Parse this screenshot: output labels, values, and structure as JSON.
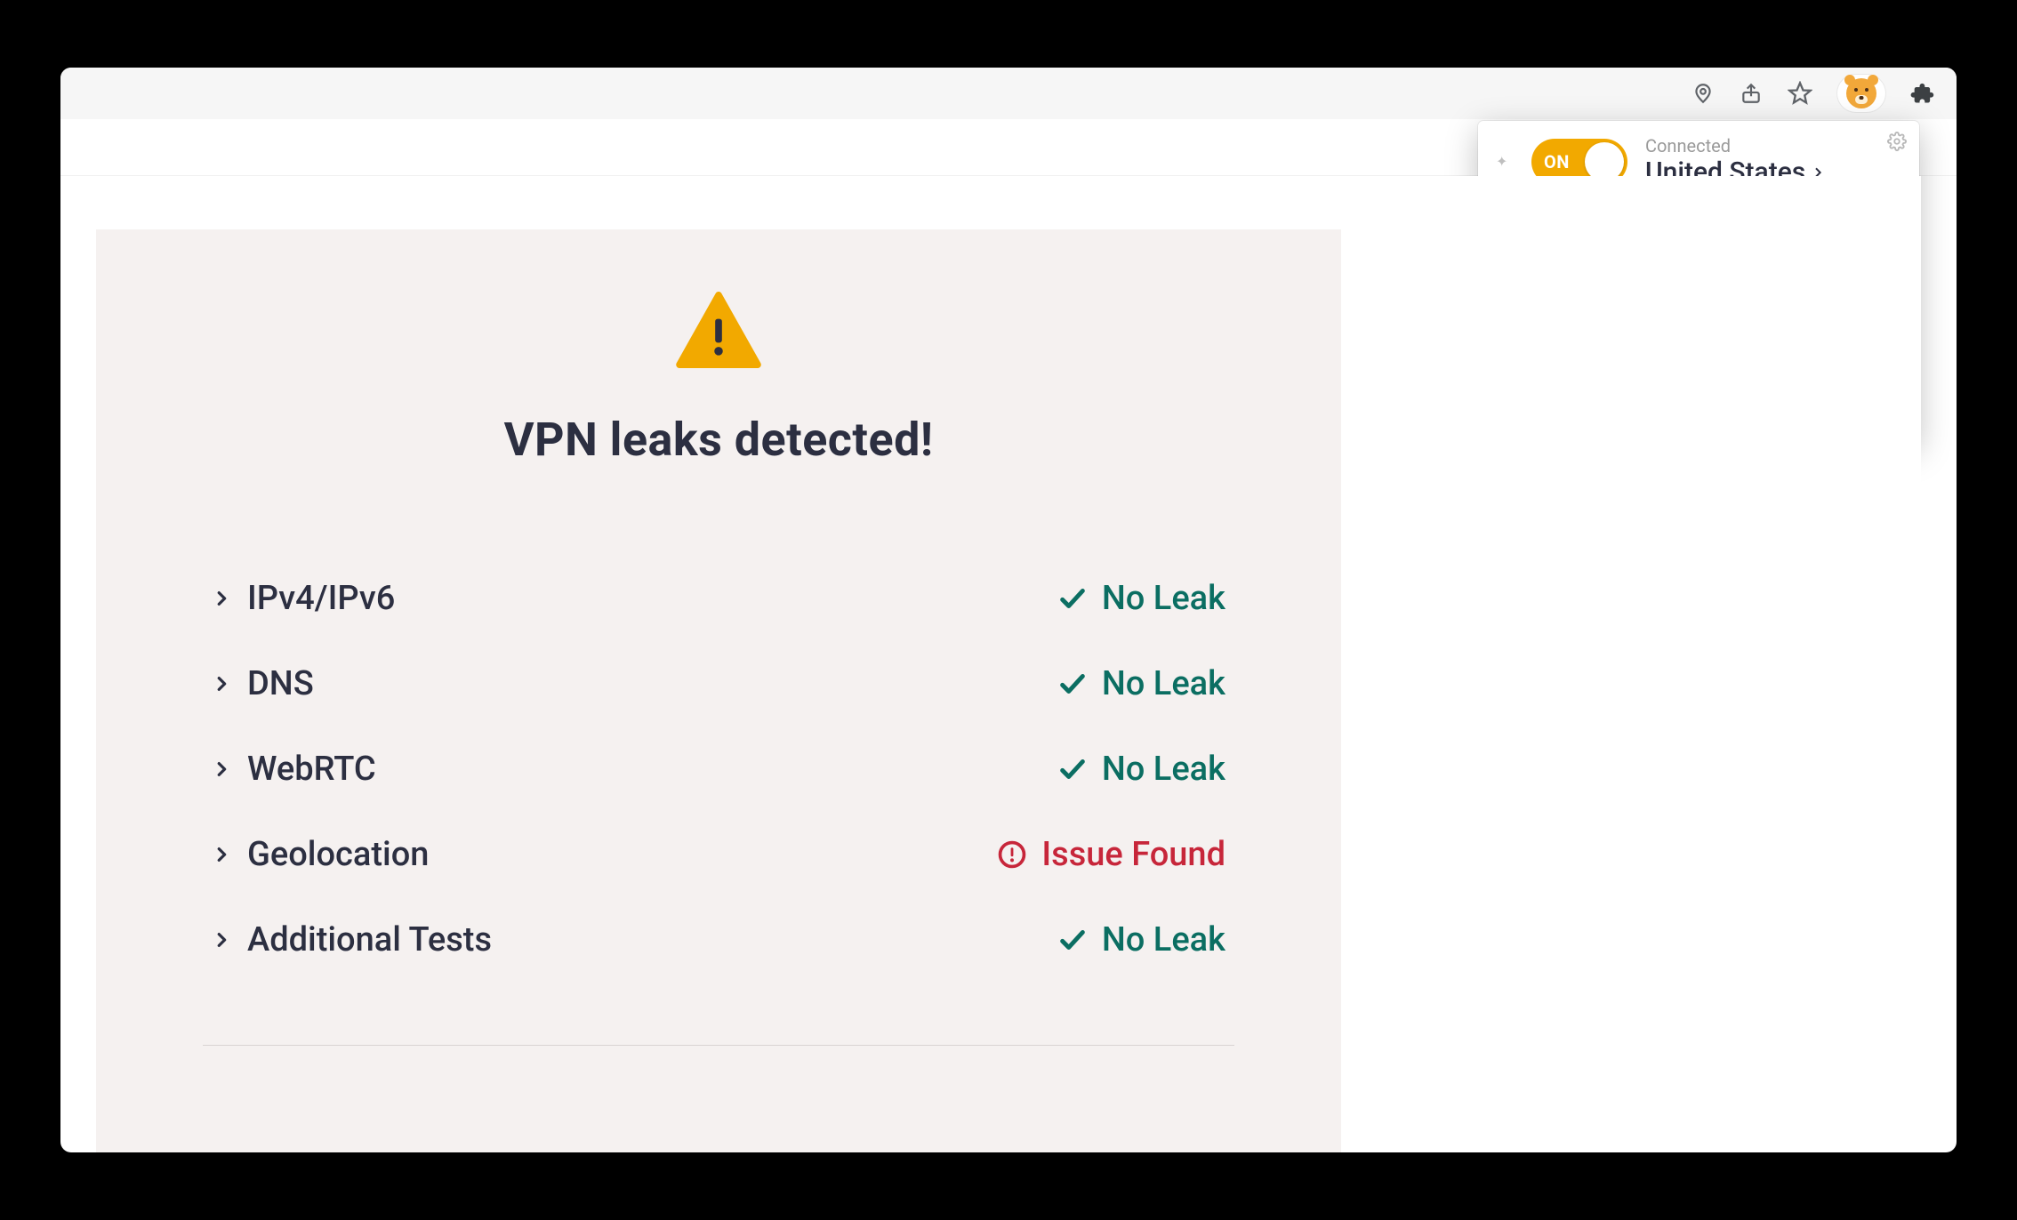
{
  "toolbar": {
    "icons": [
      "location-pin-icon",
      "share-icon",
      "star-icon",
      "vpn-extension-icon",
      "extensions-puzzle-icon"
    ]
  },
  "popup": {
    "toggle_label": "ON",
    "status_label": "Connected",
    "location": "United States"
  },
  "page": {
    "title": "VPN leaks detected!"
  },
  "tests": [
    {
      "name": "IPv4/IPv6",
      "status": "No Leak",
      "ok": true
    },
    {
      "name": "DNS",
      "status": "No Leak",
      "ok": true
    },
    {
      "name": "WebRTC",
      "status": "No Leak",
      "ok": true
    },
    {
      "name": "Geolocation",
      "status": "Issue Found",
      "ok": false
    },
    {
      "name": "Additional Tests",
      "status": "No Leak",
      "ok": true
    }
  ],
  "colors": {
    "accent": "#f2a900",
    "ok": "#0b6e62",
    "err": "#c7263a",
    "text": "#2c2f41",
    "panel": "#f5f1f0"
  }
}
